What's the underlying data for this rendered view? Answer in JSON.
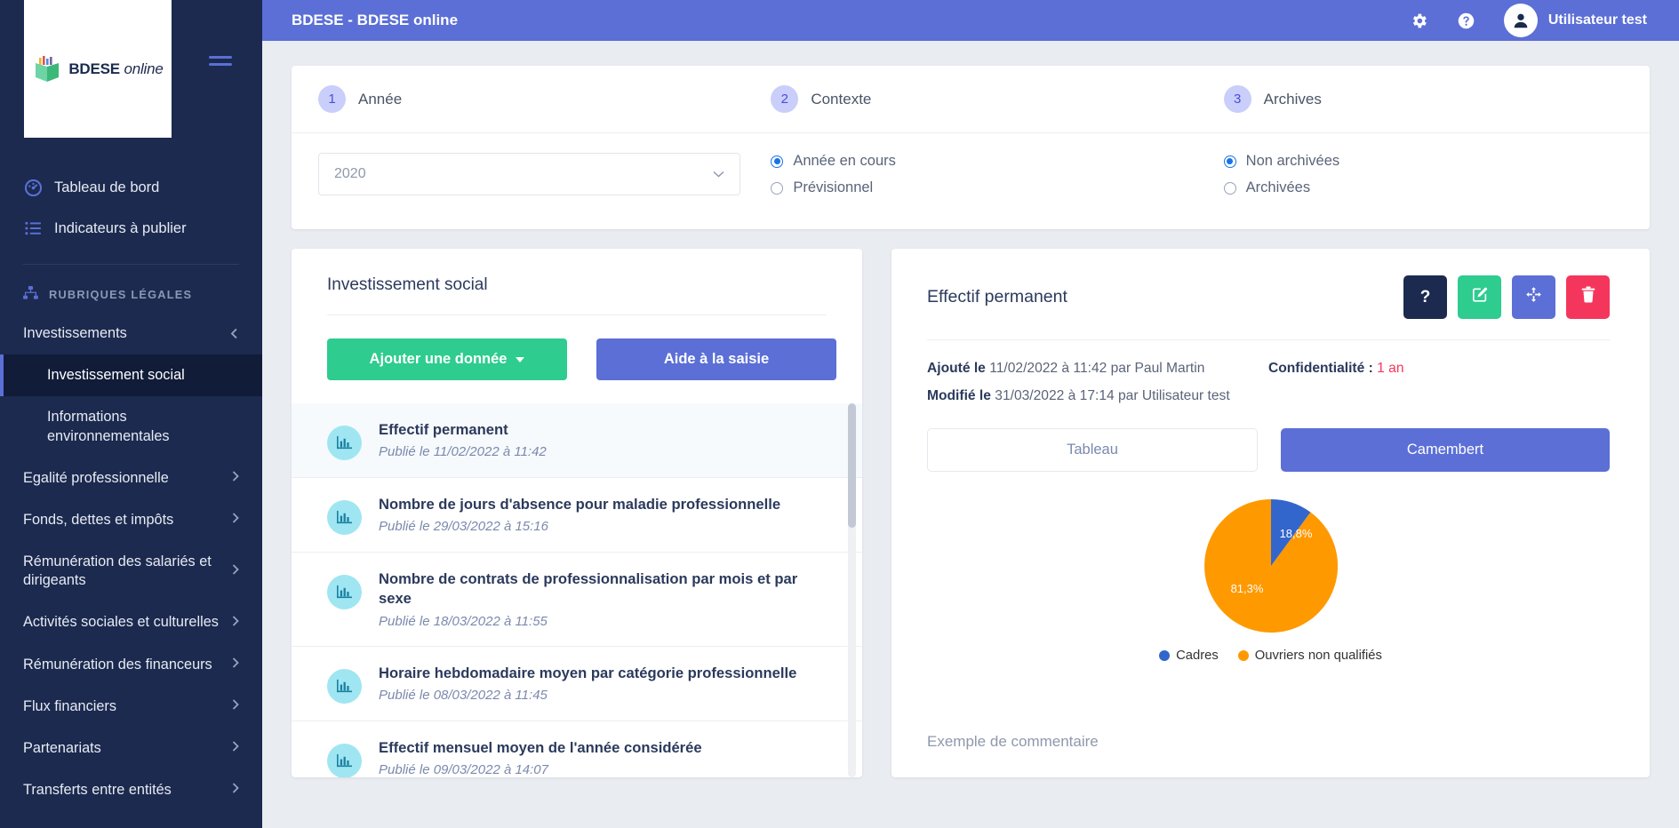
{
  "brand": {
    "logo_text_bold": "BDESE",
    "logo_text_italic": "online"
  },
  "topbar": {
    "title": "BDESE - BDESE online",
    "gear_icon": "gear-icon",
    "help_icon": "question-circle-icon",
    "user_name": "Utilisateur test"
  },
  "sidebar": {
    "links": [
      {
        "label": "Tableau de bord",
        "icon": "dashboard-icon"
      },
      {
        "label": "Indicateurs à publier",
        "icon": "list-icon"
      }
    ],
    "category": {
      "label": "RUBRIQUES LÉGALES",
      "icon": "sitemap-icon"
    },
    "items": [
      {
        "label": "Investissements",
        "state": "expanded",
        "chevron": "chevron-down-icon"
      },
      {
        "label": "Egalité professionnelle",
        "state": "collapsed",
        "chevron": "chevron-right-icon"
      },
      {
        "label": "Fonds, dettes et impôts",
        "state": "collapsed",
        "chevron": "chevron-right-icon"
      },
      {
        "label": "Rémunération des salariés et dirigeants",
        "state": "collapsed",
        "chevron": "chevron-right-icon"
      },
      {
        "label": "Activités sociales et culturelles",
        "state": "collapsed",
        "chevron": "chevron-right-icon"
      },
      {
        "label": "Rémunération des financeurs",
        "state": "collapsed",
        "chevron": "chevron-right-icon"
      },
      {
        "label": "Flux financiers",
        "state": "collapsed",
        "chevron": "chevron-right-icon"
      },
      {
        "label": "Partenariats",
        "state": "collapsed",
        "chevron": "chevron-right-icon"
      },
      {
        "label": "Transferts entre entités",
        "state": "collapsed",
        "chevron": "chevron-right-icon"
      }
    ],
    "subitems": [
      {
        "label": "Investissement social",
        "active": true
      },
      {
        "label": "Informations environnementales",
        "active": false
      }
    ]
  },
  "steps": {
    "items": [
      {
        "num": "1",
        "label": "Année"
      },
      {
        "num": "2",
        "label": "Contexte"
      },
      {
        "num": "3",
        "label": "Archives"
      }
    ],
    "year_value": "2020",
    "context_options": [
      {
        "label": "Année en cours",
        "selected": true
      },
      {
        "label": "Prévisionnel",
        "selected": false
      }
    ],
    "archive_options": [
      {
        "label": "Non archivées",
        "selected": true
      },
      {
        "label": "Archivées",
        "selected": false
      }
    ]
  },
  "left_panel": {
    "title": "Investissement social",
    "add_button": "Ajouter une donnée",
    "help_button": "Aide à la saisie",
    "items": [
      {
        "title": "Effectif permanent",
        "date": "Publié le 11/02/2022 à 11:42",
        "selected": true,
        "icon": "chart-icon"
      },
      {
        "title": "Nombre de jours d'absence pour maladie professionnelle",
        "date": "Publié le 29/03/2022 à 15:16",
        "selected": false,
        "icon": "chart-icon"
      },
      {
        "title": "Nombre de contrats de professionnalisation par mois et par sexe",
        "date": "Publié le 18/03/2022 à 11:55",
        "selected": false,
        "icon": "chart-icon"
      },
      {
        "title": "Horaire hebdomadaire moyen par catégorie professionnelle",
        "date": "Publié le 08/03/2022 à 11:45",
        "selected": false,
        "icon": "chart-icon"
      },
      {
        "title": "Effectif mensuel moyen de l'année considérée",
        "date": "Publié le 09/03/2022 à 14:07",
        "selected": false,
        "icon": "chart-icon"
      }
    ]
  },
  "right_panel": {
    "title": "Effectif permanent",
    "actions": [
      {
        "name": "help",
        "glyph": "?",
        "color": "#1b2a4e"
      },
      {
        "name": "edit",
        "glyph": "✎",
        "color": "#2ecc8f"
      },
      {
        "name": "move",
        "glyph": "✥",
        "color": "#5b6fd6"
      },
      {
        "name": "delete",
        "glyph": "🗑",
        "color": "#f5365c"
      }
    ],
    "meta": {
      "added_label": "Ajouté le",
      "added_value": "11/02/2022 à 11:42 par Paul Martin",
      "modified_label": "Modifié le",
      "modified_value": "31/03/2022 à 17:14 par Utilisateur test",
      "confidentiality_label": "Confidentialité :",
      "confidentiality_value": "1 an"
    },
    "tabs": [
      {
        "label": "Tableau",
        "active": false
      },
      {
        "label": "Camembert",
        "active": true
      }
    ],
    "comment": "Exemple de commentaire"
  },
  "chart_data": {
    "type": "pie",
    "title": "",
    "categories": [
      "Cadres",
      "Ouvriers non qualifiés"
    ],
    "values": [
      18.8,
      81.3
    ],
    "labels": [
      "18,8%",
      "81,3%"
    ],
    "colors": [
      "#3366cc",
      "#ff9900"
    ],
    "legend_position": "bottom",
    "start_angle_deg": 0
  },
  "colors": {
    "brand_indigo": "#5b6fd6",
    "sidebar_navy": "#1b2a4e",
    "green": "#2ecc8f",
    "red": "#f5365c",
    "pie_blue": "#3366cc",
    "pie_orange": "#ff9900"
  }
}
